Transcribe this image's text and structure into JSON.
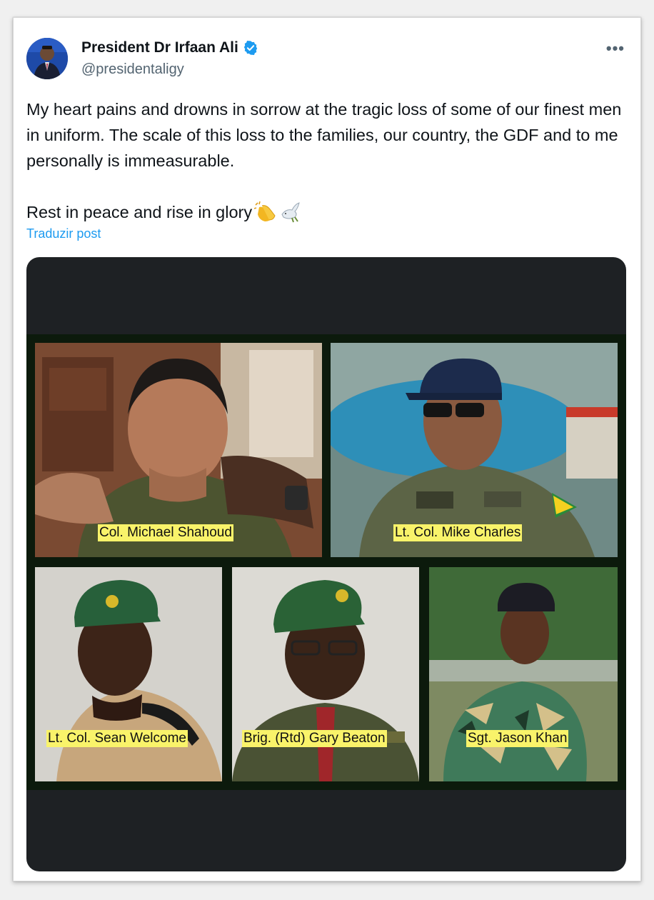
{
  "author": {
    "name": "President Dr Irfaan Ali",
    "handle": "@presidentaligy",
    "verified": true,
    "verified_icon": "verified-badge-icon",
    "avatar_icon": "avatar"
  },
  "more_label": "•••",
  "tweet": {
    "paragraph1": "My heart pains and drowns in sorrow at the tragic loss of some of our finest men in uniform. The scale of this loss to the families, our country, the GDF and to me personally is immeasurable.",
    "paragraph2": "Rest in peace and rise in glory",
    "emojis": [
      "clapping-hands-icon",
      "dove-icon"
    ]
  },
  "translate_label": "Traduzir post",
  "media": {
    "captions": [
      "Col. Michael Shahoud",
      "Lt. Col. Mike Charles",
      "Lt. Col. Sean Welcome",
      "Brig. (Rtd) Gary Beaton",
      "Sgt. Jason Khan"
    ]
  },
  "colors": {
    "link": "#1d9bf0",
    "text": "#0f1419",
    "secondary": "#536471",
    "caption_bg": "#f9f36a",
    "media_bg": "#1e2124",
    "collage_border": "#0c1a0c"
  }
}
